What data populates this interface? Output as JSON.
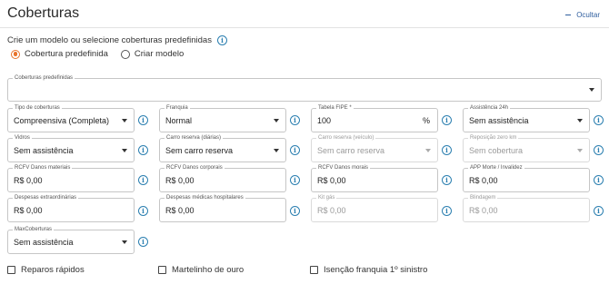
{
  "header": {
    "title": "Coberturas",
    "hide_label": "Ocultar"
  },
  "prompt": {
    "text": "Crie um modelo ou selecione coberturas predefinidas"
  },
  "mode": {
    "options": [
      {
        "label": "Cobertura predefinida",
        "selected": true
      },
      {
        "label": "Criar modelo",
        "selected": false
      }
    ]
  },
  "predefined": {
    "label": "Coberturas predefinidas",
    "value": ""
  },
  "fields": {
    "tipo": {
      "label": "Tipo de coberturas",
      "value": "Compreensiva (Completa)"
    },
    "franquia": {
      "label": "Franquia",
      "value": "Normal"
    },
    "fipe": {
      "label": "Tabela FIPE *",
      "value": "100",
      "suffix": "%"
    },
    "assist24": {
      "label": "Assistência 24h",
      "value": "Sem assistência"
    },
    "vidros": {
      "label": "Vidros",
      "value": "Sem assistência"
    },
    "carro_dias": {
      "label": "Carro reserva (diárias)",
      "value": "Sem carro reserva"
    },
    "carro_veiculo": {
      "label": "Carro reserva (veículo)",
      "value": "Sem carro reserva"
    },
    "repos": {
      "label": "Reposição zero km",
      "value": "Sem cobertura"
    },
    "rcfv_mat": {
      "label": "RCFV Danos materiais",
      "value": "R$ 0,00"
    },
    "rcfv_corp": {
      "label": "RCFV Danos corporais",
      "value": "R$ 0,00"
    },
    "rcfv_morais": {
      "label": "RCFV Danos morais",
      "value": "R$ 0,00"
    },
    "app": {
      "label": "APP Morte / Invalidez",
      "value": "R$ 0,00"
    },
    "desp_ext": {
      "label": "Despesas extraordinárias",
      "value": "R$ 0,00"
    },
    "desp_med": {
      "label": "Despesas médicas hospitalares",
      "value": "R$ 0,00"
    },
    "kit_gas": {
      "label": "Kit gás",
      "value": "R$ 0,00"
    },
    "blindagem": {
      "label": "Blindagem",
      "value": "R$ 0,00"
    },
    "max": {
      "label": "MaxCoberturas",
      "value": "Sem assistência"
    }
  },
  "checkboxes": [
    {
      "label": "Reparos rápidos",
      "checked": false
    },
    {
      "label": "Martelinho de ouro",
      "checked": false
    },
    {
      "label": "Isenção franquia 1º sinistro",
      "checked": false
    }
  ],
  "icons": {
    "info": "info-icon",
    "caret": "chevron-down-icon",
    "hide": "minus-icon"
  },
  "colors": {
    "accent": "#e8742c",
    "info": "#2b7fb0",
    "link": "#2f5e9e"
  }
}
